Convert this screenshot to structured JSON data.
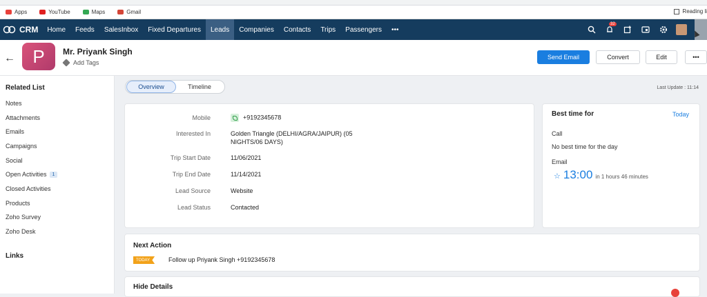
{
  "browser": {
    "bookmarks": [
      {
        "label": "Apps",
        "color": "#e8413a"
      },
      {
        "label": "YouTube",
        "color": "#e02020"
      },
      {
        "label": "Maps",
        "color": "#34a853"
      },
      {
        "label": "Gmail",
        "color": "#d44638"
      }
    ],
    "reading_list": "Reading li"
  },
  "nav": {
    "logo": "CRM",
    "items": [
      "Home",
      "Feeds",
      "SalesInbox",
      "Fixed Departures",
      "Leads",
      "Companies",
      "Contacts",
      "Trips",
      "Passengers",
      "•••"
    ],
    "active_index": 4,
    "notification_count": "32",
    "colors": {
      "bar": "#153c5e",
      "active": "#3b5f83"
    }
  },
  "record": {
    "avatar_letter": "P",
    "name": "Mr. Priyank Singh",
    "add_tags": "Add Tags",
    "buttons": {
      "send_email": "Send Email",
      "convert": "Convert",
      "edit": "Edit",
      "more": "•••"
    }
  },
  "sidebar": {
    "title": "Related List",
    "items": [
      {
        "label": "Notes"
      },
      {
        "label": "Attachments"
      },
      {
        "label": "Emails"
      },
      {
        "label": "Campaigns"
      },
      {
        "label": "Social"
      },
      {
        "label": "Open Activities",
        "badge": "1"
      },
      {
        "label": "Closed Activities"
      },
      {
        "label": "Products"
      },
      {
        "label": "Zoho Survey"
      },
      {
        "label": "Zoho Desk"
      }
    ],
    "links_title": "Links"
  },
  "tabs": {
    "overview": "Overview",
    "timeline": "Timeline"
  },
  "last_update": "Last Update : 11:14",
  "details": {
    "fields": [
      {
        "label": "Mobile",
        "value": "+9192345678"
      },
      {
        "label": "Interested In",
        "value": "Golden Triangle (DELHI/AGRA/JAIPUR) (05",
        "value2": "NIGHTS/06 DAYS)"
      },
      {
        "label": "Trip Start Date",
        "value": "11/06/2021"
      },
      {
        "label": "Trip End Date",
        "value": "11/14/2021"
      },
      {
        "label": "Lead Source",
        "value": "Website"
      },
      {
        "label": "Lead Status",
        "value": "Contacted"
      }
    ]
  },
  "best_time": {
    "title": "Best time for",
    "today": "Today",
    "call_label": "Call",
    "call_value": "No best time for the day",
    "email_label": "Email",
    "time": "13:00",
    "relative": "in 1 hours 46 minutes"
  },
  "next_action": {
    "title": "Next Action",
    "tag": "TODAY",
    "text": "Follow up Priyank Singh +9192345678"
  },
  "hide_details": "Hide Details"
}
